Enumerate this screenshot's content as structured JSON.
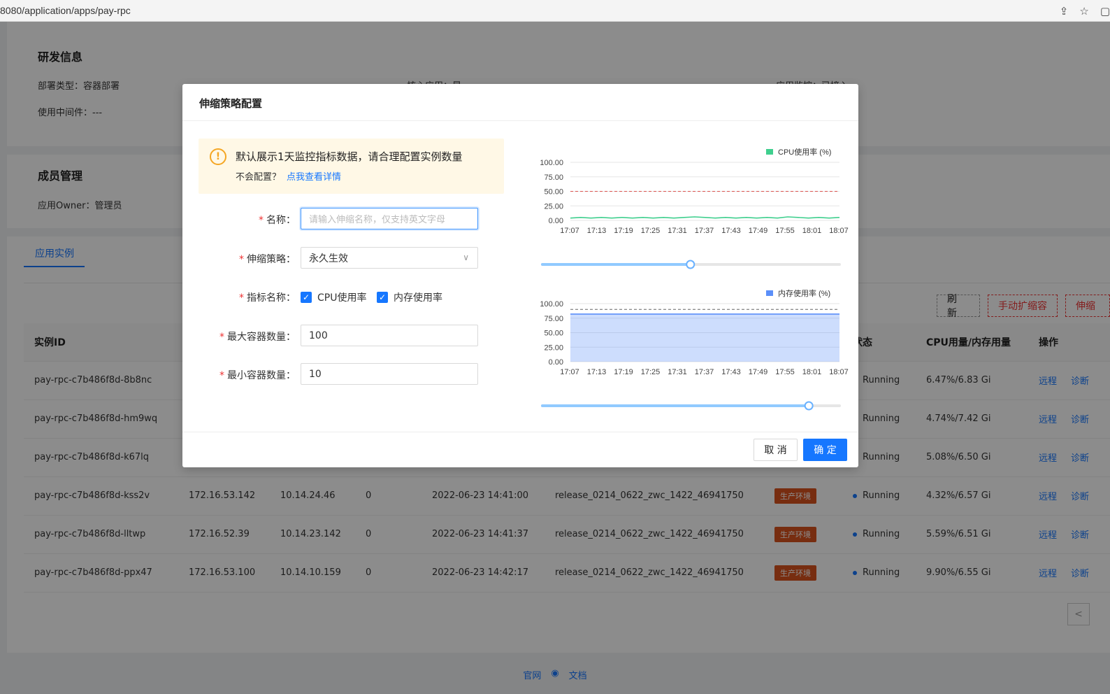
{
  "browser": {
    "url": "8080/application/apps/pay-rpc",
    "tools": [
      "share-icon",
      "star-icon",
      "window-icon"
    ]
  },
  "page": {
    "dev_info": {
      "title": "研发信息",
      "deploy_type": "部署类型：容器部署",
      "middleware": "使用中间件：---",
      "core_app": "核心应用：是",
      "monitor": "应用监控：已接入"
    },
    "members": {
      "title": "成员管理",
      "owner": "应用Owner：管理员"
    },
    "tab": "应用实例",
    "buttons": {
      "refresh": "刷 新",
      "manual_scale": "手动扩缩容",
      "scale": "伸缩"
    },
    "table": {
      "headers": [
        "实例ID",
        "",
        "",
        "",
        "",
        "",
        "",
        "状态",
        "CPU用量/内存用量",
        "操作"
      ],
      "header_status": "状态",
      "rows": [
        {
          "id": "pay-rpc-c7b486f8d-8b8nc",
          "ip1": "",
          "ip2": "",
          "restarts": "",
          "time": "",
          "release": "",
          "env": "",
          "status": "Running",
          "usage": "6.47%/6.83 Gi",
          "op1": "远程",
          "op2": "诊断"
        },
        {
          "id": "pay-rpc-c7b486f8d-hm9wq",
          "ip1": "",
          "ip2": "",
          "restarts": "",
          "time": "",
          "release": "",
          "env": "",
          "status": "Running",
          "usage": "4.74%/7.42 Gi",
          "op1": "远程",
          "op2": "诊断"
        },
        {
          "id": "pay-rpc-c7b486f8d-k67lq",
          "ip1": "",
          "ip2": "",
          "restarts": "",
          "time": "",
          "release": "",
          "env": "",
          "status": "Running",
          "usage": "5.08%/6.50 Gi",
          "op1": "远程",
          "op2": "诊断"
        },
        {
          "id": "pay-rpc-c7b486f8d-kss2v",
          "ip1": "172.16.53.142",
          "ip2": "10.14.24.46",
          "restarts": "0",
          "time": "2022-06-23 14:41:00",
          "release": "release_0214_0622_zwc_1422_46941750",
          "env": "生产环境",
          "status": "Running",
          "usage": "4.32%/6.57 Gi",
          "op1": "远程",
          "op2": "诊断"
        },
        {
          "id": "pay-rpc-c7b486f8d-lltwp",
          "ip1": "172.16.52.39",
          "ip2": "10.14.23.142",
          "restarts": "0",
          "time": "2022-06-23 14:41:37",
          "release": "release_0214_0622_zwc_1422_46941750",
          "env": "生产环境",
          "status": "Running",
          "usage": "5.59%/6.51 Gi",
          "op1": "远程",
          "op2": "诊断"
        },
        {
          "id": "pay-rpc-c7b486f8d-ppx47",
          "ip1": "172.16.53.100",
          "ip2": "10.14.10.159",
          "restarts": "0",
          "time": "2022-06-23 14:42:17",
          "release": "release_0214_0622_zwc_1422_46941750",
          "env": "生产环境",
          "status": "Running",
          "usage": "9.90%/6.55 Gi",
          "op1": "远程",
          "op2": "诊断"
        }
      ]
    },
    "pager_prev": "<",
    "footer": {
      "site": "官网",
      "docs": "文档"
    }
  },
  "modal": {
    "title": "伸缩策略配置",
    "alert": {
      "title": "默认展示1天监控指标数据，请合理配置实例数量",
      "sub": "不会配置？",
      "link": "点我查看详情",
      "icon": "!"
    },
    "form": {
      "name_label": "名称：",
      "name_placeholder": "请输入伸缩名称，仅支持英文字母",
      "policy_label": "伸缩策略：",
      "policy_value": "永久生效",
      "metric_label": "指标名称：",
      "metric_cpu": "CPU使用率",
      "metric_mem": "内存使用率",
      "max_label": "最大容器数量：",
      "max_value": "100",
      "min_label": "最小容器数量：",
      "min_value": "10",
      "required_mark": "*"
    },
    "cancel": "取 消",
    "ok": "确 定"
  },
  "chart_data": [
    {
      "type": "line",
      "legend": "CPU使用率 (%)",
      "x": [
        "17:07",
        "17:13",
        "17:19",
        "17:25",
        "17:31",
        "17:37",
        "17:43",
        "17:49",
        "17:55",
        "18:01",
        "18:07"
      ],
      "y_ticks": [
        "0.00",
        "25.00",
        "50.00",
        "75.00",
        "100.00"
      ],
      "ylim": [
        0,
        100
      ],
      "values": [
        4,
        5,
        4,
        5,
        4,
        5,
        4,
        5,
        4,
        5,
        4,
        5,
        6,
        5,
        4,
        5,
        4,
        5,
        4,
        5,
        4,
        6,
        5,
        4,
        5,
        4,
        5
      ],
      "threshold": 50,
      "color": "#3fcf8e",
      "slider": 0.55
    },
    {
      "type": "area",
      "legend": "内存使用率 (%)",
      "x": [
        "17:07",
        "17:13",
        "17:19",
        "17:25",
        "17:31",
        "17:37",
        "17:43",
        "17:49",
        "17:55",
        "18:01",
        "18:07"
      ],
      "y_ticks": [
        "0.00",
        "25.00",
        "50.00",
        "75.00",
        "100.00"
      ],
      "ylim": [
        0,
        100
      ],
      "values": [
        82,
        82,
        82,
        82,
        82,
        82,
        82,
        82,
        82,
        82,
        82,
        82,
        82
      ],
      "threshold": 90,
      "color": "#5b8ff9",
      "slider": 0.99
    }
  ]
}
